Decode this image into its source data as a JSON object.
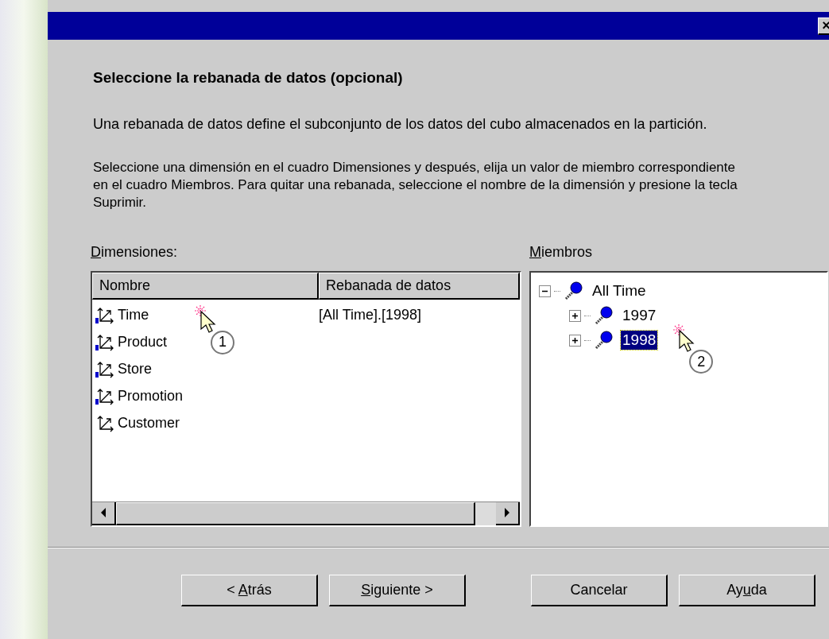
{
  "window": {
    "close": "×"
  },
  "heading": "Seleccione la rebanada de datos (opcional)",
  "paragraphs": [
    "Una rebanada de datos define el subconjunto de los datos del cubo almacenados en la partición.",
    "Seleccione una dimensión en el cuadro Dimensiones y después, elija un valor de miembro correspondiente en el cuadro Miembros. Para quitar una rebanada, seleccione el nombre de la dimensión y presione la tecla Suprimir."
  ],
  "dimensions": {
    "label": {
      "key": "D",
      "post": "imensiones:"
    },
    "columns": [
      "Nombre",
      "Rebanada de datos"
    ],
    "rows": [
      {
        "name": "Time",
        "kind": "marked",
        "slice": "[All Time].[1998]",
        "callout": "1"
      },
      {
        "name": "Product",
        "kind": "marked"
      },
      {
        "name": "Store",
        "kind": "marked"
      },
      {
        "name": "Promotion",
        "kind": "marked"
      },
      {
        "name": "Customer",
        "kind": "plain"
      }
    ]
  },
  "members": {
    "label": {
      "key": "M",
      "post": "iembros"
    },
    "tree": [
      {
        "label": "All Time",
        "expanded": true,
        "selected": false,
        "children": [
          {
            "label": "1997",
            "expanded": false,
            "selected": false
          },
          {
            "label": "1998",
            "expanded": false,
            "selected": true,
            "callout": "2"
          }
        ]
      }
    ]
  },
  "buttons": [
    {
      "pre": "< ",
      "key": "A",
      "post": "trás"
    },
    {
      "key": "S",
      "post": "iguiente >"
    },
    {
      "pre": "Cancelar"
    },
    {
      "pre": "Ay",
      "key": "u",
      "post": "da"
    }
  ]
}
